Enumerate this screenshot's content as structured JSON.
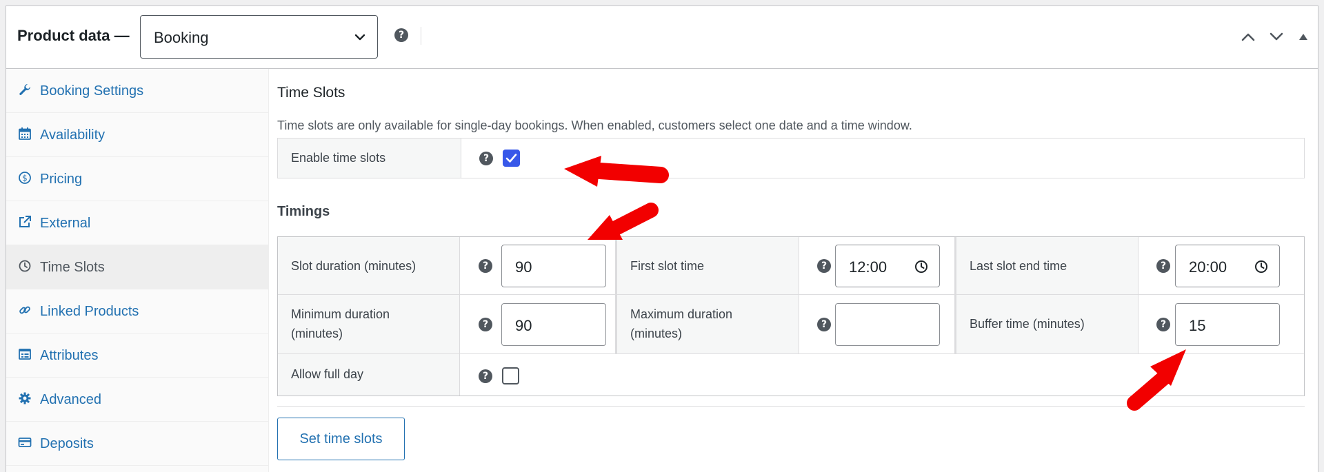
{
  "header": {
    "title": "Product data —",
    "product_type": "Booking",
    "help": "?"
  },
  "sidebar": {
    "items": [
      {
        "label": "Booking Settings",
        "icon": "wrench-icon",
        "active": false
      },
      {
        "label": "Availability",
        "icon": "calendar-icon",
        "active": false
      },
      {
        "label": "Pricing",
        "icon": "dollar-icon",
        "active": false
      },
      {
        "label": "External",
        "icon": "external-link-icon",
        "active": false
      },
      {
        "label": "Time Slots",
        "icon": "clock-icon",
        "active": true
      },
      {
        "label": "Linked Products",
        "icon": "link-icon",
        "active": false
      },
      {
        "label": "Attributes",
        "icon": "attributes-icon",
        "active": false
      },
      {
        "label": "Advanced",
        "icon": "gear-icon",
        "active": false
      },
      {
        "label": "Deposits",
        "icon": "card-icon",
        "active": false
      }
    ]
  },
  "main": {
    "section_title": "Time Slots",
    "description": "Time slots are only available for single-day bookings. When enabled, customers select one date and a time window.",
    "enable_time_slots": {
      "label": "Enable time slots",
      "checked": true
    },
    "timings_title": "Timings",
    "fields": {
      "slot_duration": {
        "label": "Slot duration (minutes)",
        "value": "90"
      },
      "first_slot_time": {
        "label": "First slot time",
        "value": "12:00"
      },
      "last_slot_end_time": {
        "label": "Last slot end time",
        "value": "20:00"
      },
      "minimum_duration": {
        "label_line1": "Minimum duration",
        "label_line2": "(minutes)",
        "value": "90"
      },
      "maximum_duration": {
        "label_line1": "Maximum duration",
        "label_line2": "(minutes)",
        "value": ""
      },
      "buffer_time": {
        "label": "Buffer time (minutes)",
        "value": "15"
      },
      "allow_full_day": {
        "label": "Allow full day",
        "checked": false
      }
    },
    "set_time_slots_label": "Set time slots"
  },
  "colors": {
    "link": "#2271b1",
    "checkbox_checked": "#3858e9",
    "annotation_arrow": "#ff0000"
  }
}
